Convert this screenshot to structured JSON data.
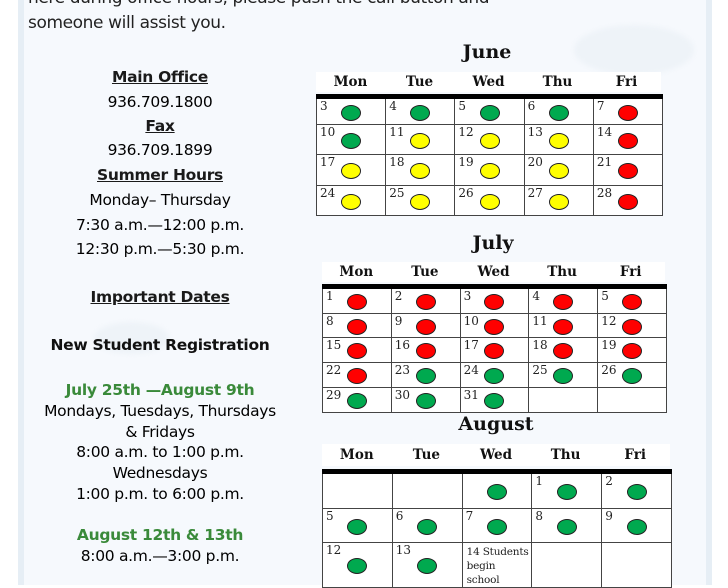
{
  "intro": {
    "line1": "here during office hours, please push the call button and",
    "line2": "someone will assist you."
  },
  "contact": {
    "main_office_label": "Main Office",
    "main_office_phone": "936.709.1800",
    "fax_label": "Fax",
    "fax_number": "936.709.1899",
    "summer_hours_label": "Summer Hours",
    "summer_days": "Monday– Thursday",
    "summer_hours_1": "7:30 a.m.—12:00 p.m.",
    "summer_hours_2": "12:30 p.m.—5:30 p.m."
  },
  "important_dates": {
    "label": "Important Dates",
    "registration_label": "New Student Registration",
    "period1_dates": "July 25th —August 9th",
    "period1_days_a": "Mondays, Tuesdays, Thursdays",
    "period1_days_b": "& Fridays",
    "period1_hours_a": "8:00 a.m. to 1:00 p.m.",
    "period1_days_c": "Wednesdays",
    "period1_hours_b": "1:00 p.m. to 6:00 p.m.",
    "period2_dates": "August 12th & 13th",
    "period2_hours": "8:00 a.m.—3:00 p.m."
  },
  "status_colors": {
    "green": "#00a94f",
    "yellow": "#ffff00",
    "red": "#ff0000"
  },
  "calendars": [
    {
      "month": "June",
      "weekdays": [
        "Mon",
        "Tue",
        "Wed",
        "Thu",
        "Fri"
      ],
      "weeks": [
        [
          {
            "day": "3",
            "status": "green"
          },
          {
            "day": "4",
            "status": "green"
          },
          {
            "day": "5",
            "status": "green"
          },
          {
            "day": "6",
            "status": "green"
          },
          {
            "day": "7",
            "status": "red"
          }
        ],
        [
          {
            "day": "10",
            "status": "green"
          },
          {
            "day": "11",
            "status": "yellow"
          },
          {
            "day": "12",
            "status": "yellow"
          },
          {
            "day": "13",
            "status": "yellow"
          },
          {
            "day": "14",
            "status": "red"
          }
        ],
        [
          {
            "day": "17",
            "status": "yellow"
          },
          {
            "day": "18",
            "status": "yellow"
          },
          {
            "day": "19",
            "status": "yellow"
          },
          {
            "day": "20",
            "status": "yellow"
          },
          {
            "day": "21",
            "status": "red"
          }
        ],
        [
          {
            "day": "24",
            "status": "yellow"
          },
          {
            "day": "25",
            "status": "yellow"
          },
          {
            "day": "26",
            "status": "yellow"
          },
          {
            "day": "27",
            "status": "yellow"
          },
          {
            "day": "28",
            "status": "red"
          }
        ]
      ]
    },
    {
      "month": "July",
      "weekdays": [
        "Mon",
        "Tue",
        "Wed",
        "Thu",
        "Fri"
      ],
      "weeks": [
        [
          {
            "day": "1",
            "status": "red"
          },
          {
            "day": "2",
            "status": "red"
          },
          {
            "day": "3",
            "status": "red"
          },
          {
            "day": "4",
            "status": "red"
          },
          {
            "day": "5",
            "status": "red"
          }
        ],
        [
          {
            "day": "8",
            "status": "red"
          },
          {
            "day": "9",
            "status": "red"
          },
          {
            "day": "10",
            "status": "red"
          },
          {
            "day": "11",
            "status": "red"
          },
          {
            "day": "12",
            "status": "red"
          }
        ],
        [
          {
            "day": "15",
            "status": "red"
          },
          {
            "day": "16",
            "status": "red"
          },
          {
            "day": "17",
            "status": "red"
          },
          {
            "day": "18",
            "status": "red"
          },
          {
            "day": "19",
            "status": "red"
          }
        ],
        [
          {
            "day": "22",
            "status": "red"
          },
          {
            "day": "23",
            "status": "green"
          },
          {
            "day": "24",
            "status": "green"
          },
          {
            "day": "25",
            "status": "green"
          },
          {
            "day": "26",
            "status": "green"
          }
        ],
        [
          {
            "day": "29",
            "status": "green"
          },
          {
            "day": "30",
            "status": "green"
          },
          {
            "day": "31",
            "status": "green"
          },
          {
            "day": "",
            "status": ""
          },
          {
            "day": "",
            "status": ""
          }
        ]
      ]
    },
    {
      "month": "August",
      "weekdays": [
        "Mon",
        "Tue",
        "Wed",
        "Thu",
        "Fri"
      ],
      "weeks": [
        [
          {
            "day": "",
            "status": ""
          },
          {
            "day": "",
            "status": ""
          },
          {
            "day": "",
            "status": "green"
          },
          {
            "day": "1",
            "status": "green"
          },
          {
            "day": "2",
            "status": "green"
          }
        ],
        [
          {
            "day": "5",
            "status": "green"
          },
          {
            "day": "6",
            "status": "green"
          },
          {
            "day": "7",
            "status": "green"
          },
          {
            "day": "8",
            "status": "green"
          },
          {
            "day": "9",
            "status": "green"
          }
        ],
        [
          {
            "day": "12",
            "status": "green"
          },
          {
            "day": "13",
            "status": "green"
          },
          {
            "day": "",
            "status": "",
            "note": "14 Students begin school"
          },
          {
            "day": "",
            "status": ""
          },
          {
            "day": "",
            "status": ""
          }
        ]
      ]
    }
  ]
}
